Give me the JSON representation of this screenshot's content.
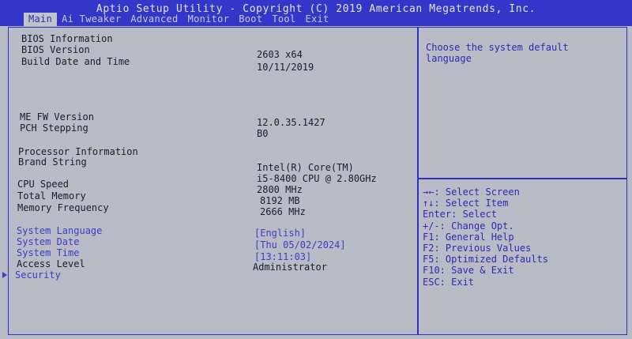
{
  "header": {
    "title": "Aptio Setup Utility - Copyright (C) 2019 American Megatrends, Inc.",
    "tabs": [
      "Main",
      "Ai Tweaker",
      "Advanced",
      "Monitor",
      "Boot",
      "Tool",
      "Exit"
    ],
    "active_tab": "Main"
  },
  "bios": {
    "info_heading": "BIOS Information",
    "version_label": "BIOS Version",
    "version_value": "2603  x64",
    "build_label": "Build Date and Time",
    "build_value": "10/11/2019",
    "mefw_label": "ME FW Version",
    "mefw_value": "12.0.35.1427",
    "pch_label": "PCH Stepping",
    "pch_value": "B0"
  },
  "processor": {
    "heading": "Processor Information",
    "brand_label": "Brand String",
    "brand_value_1": "Intel(R) Core(TM)",
    "brand_value_2": "i5-8400 CPU @ 2.80GHz",
    "speed_label": "CPU Speed",
    "speed_value": "2800 MHz",
    "memory_label": "Total Memory",
    "memory_value": "8192 MB",
    "freq_label": "Memory Frequency",
    "freq_value": "2666 MHz"
  },
  "settings": {
    "language_label": "System Language",
    "language_value": "[English]",
    "date_label": "System Date",
    "date_value": "[Thu 05/02/2024]",
    "time_label": "System Time",
    "time_value": "[13:11:03]",
    "access_label": "Access Level",
    "access_value": "Administrator",
    "security_label": "Security"
  },
  "help": {
    "text": "Choose the system default language"
  },
  "keys": [
    "→←: Select Screen",
    "↑↓: Select Item",
    "Enter: Select",
    "+/-: Change Opt.",
    "F1: General Help",
    "F2: Previous Values",
    "F5: Optimized Defaults",
    "F10: Save & Exit",
    "ESC: Exit"
  ],
  "colors": {
    "header_bg": "#3336c8",
    "panel_bg": "#b9bcc6",
    "accent": "#2a2db0"
  }
}
